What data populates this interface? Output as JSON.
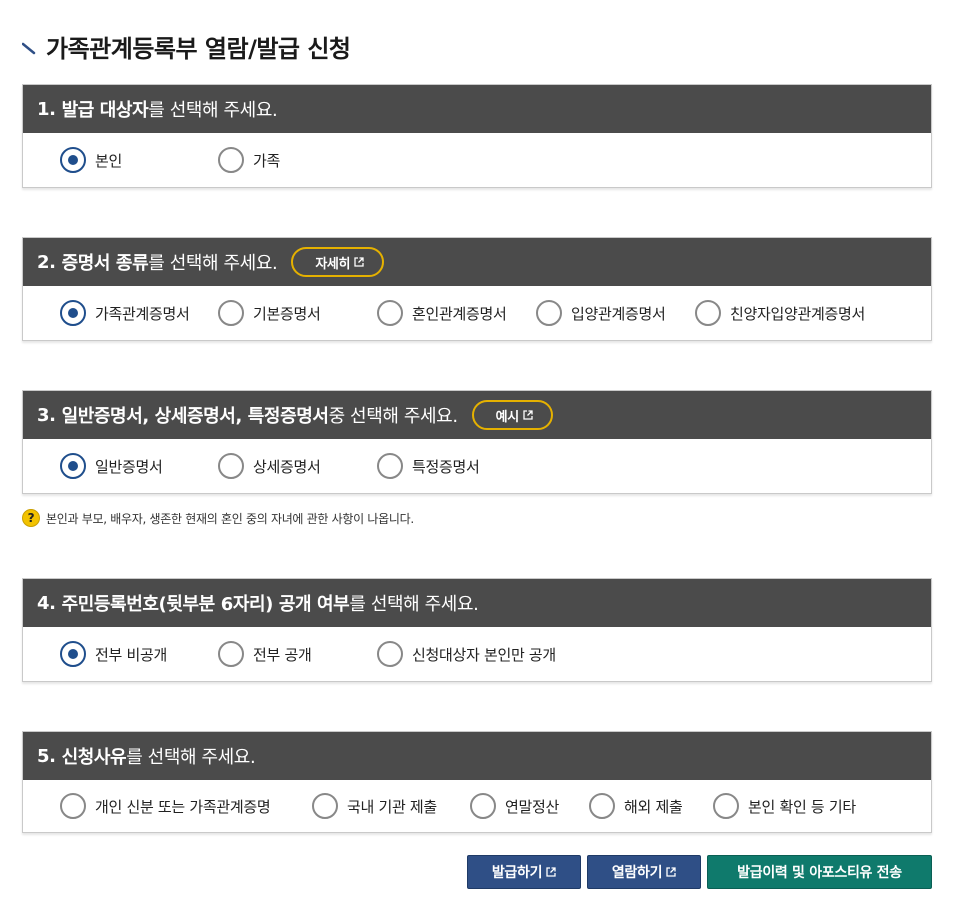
{
  "page": {
    "title": "가족관계등록부 열람/발급 신청"
  },
  "sections": [
    {
      "num": "1.",
      "strong": "발급 대상자",
      "rest": "를 선택해 주세요.",
      "options": [
        {
          "label": "본인",
          "checked": true
        },
        {
          "label": "가족",
          "checked": false
        }
      ]
    },
    {
      "num": "2.",
      "strong": "증명서 종류",
      "rest": "를 선택해 주세요.",
      "button": "자세히",
      "options": [
        {
          "label": "가족관계증명서",
          "checked": true
        },
        {
          "label": "기본증명서",
          "checked": false
        },
        {
          "label": "혼인관계증명서",
          "checked": false
        },
        {
          "label": "입양관계증명서",
          "checked": false
        },
        {
          "label": "친양자입양관계증명서",
          "checked": false
        }
      ]
    },
    {
      "num": "3.",
      "strong": "일반증명서, 상세증명서, 특정증명서",
      "rest": " 중 선택해 주세요.",
      "button": "예시",
      "options": [
        {
          "label": "일반증명서",
          "checked": true
        },
        {
          "label": "상세증명서",
          "checked": false
        },
        {
          "label": "특정증명서",
          "checked": false
        }
      ]
    },
    {
      "num": "4.",
      "strong": "주민등록번호(뒷부분 6자리) 공개 여부",
      "rest": "를 선택해 주세요.",
      "options": [
        {
          "label": "전부 비공개",
          "checked": true
        },
        {
          "label": "전부 공개",
          "checked": false
        },
        {
          "label": "신청대상자 본인만 공개",
          "checked": false
        }
      ]
    },
    {
      "num": "5.",
      "strong": "신청사유",
      "rest": "를 선택해 주세요.",
      "options": [
        {
          "label": "개인 신분 또는 가족관계증명",
          "checked": false
        },
        {
          "label": "국내 기관 제출",
          "checked": false
        },
        {
          "label": "연말정산",
          "checked": false
        },
        {
          "label": "해외 제출",
          "checked": false
        },
        {
          "label": "본인 확인 등 기타",
          "checked": false
        }
      ]
    }
  ],
  "help": {
    "icon": "question-icon",
    "text": "본인과 부모, 배우자, 생존한 현재의 혼인 중의 자녀에 관한 사항이 나옵니다."
  },
  "actions": {
    "issue": "발급하기",
    "view": "열람하기",
    "history": "발급이력 및 아포스티유 전송"
  },
  "colors": {
    "header": "#4b4b4b",
    "radio": "#1f4e8c",
    "pill_border": "#e5b100",
    "blue_button": "#2f4f86",
    "green_button": "#0f7a6c"
  }
}
